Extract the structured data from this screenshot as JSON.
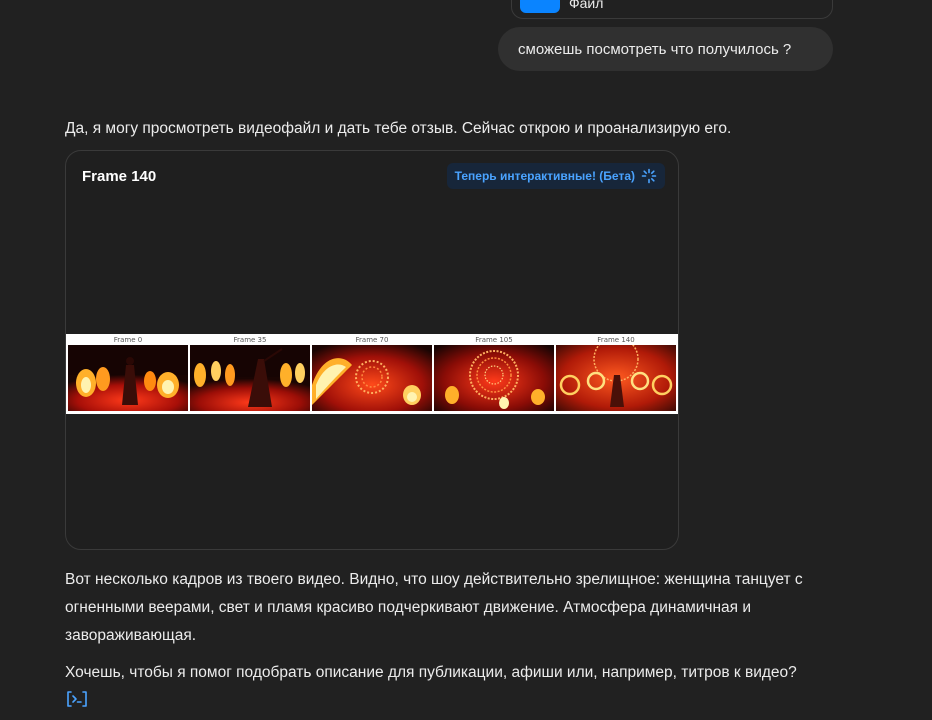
{
  "file_bubble": {
    "label": "Файл"
  },
  "user_message": "сможешь посмотреть что получилось  ?",
  "assistant": {
    "intro": "Да, я могу просмотреть видеофайл и дать тебе отзыв. Сейчас открою и проанализирую его.",
    "card": {
      "title": "Frame 140",
      "badge": "Теперь интерактивные! (Бета)",
      "frames": [
        {
          "label": "Frame 0"
        },
        {
          "label": "Frame 35"
        },
        {
          "label": "Frame 70"
        },
        {
          "label": "Frame 105"
        },
        {
          "label": "Frame 140"
        }
      ]
    },
    "paragraph": "Вот несколько кадров из твоего видео. Видно, что шоу действительно зрелищное: женщина танцует с огненными веерами, свет и пламя красиво подчеркивают движение. Атмосфера динамичная и завораживающая.",
    "question": "Хочешь, чтобы я помог подобрать описание для публикации, афиши или, например, титров к видео?"
  },
  "colors": {
    "background": "#212121",
    "user_bubble": "#303030",
    "accent": "#4aa3ff",
    "file_icon": "#0a84ff"
  },
  "icons": [
    "file-icon",
    "sparkle-icon",
    "code-icon"
  ]
}
